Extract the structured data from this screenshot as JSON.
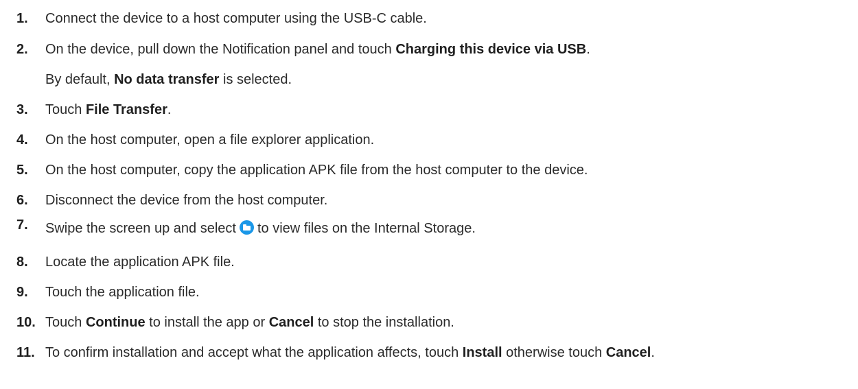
{
  "steps": [
    {
      "num": "1.",
      "text": "Connect the device to a host computer using the USB-C cable."
    },
    {
      "num": "2.",
      "pre": "On the device, pull down the Notification panel and touch ",
      "b1": "Charging this device via USB",
      "post": "."
    },
    {
      "note_pre": "By default, ",
      "note_b": "No data transfer",
      "note_post": " is selected."
    },
    {
      "num": "3.",
      "pre": "Touch ",
      "b1": "File Transfer",
      "post": "."
    },
    {
      "num": "4.",
      "text": "On the host computer, open a file explorer application."
    },
    {
      "num": "5.",
      "text": "On the host computer, copy the application APK file from the host computer to the device."
    },
    {
      "num": "6.",
      "text": "Disconnect the device from the host computer."
    },
    {
      "num": "7.",
      "pre": "Swipe the screen up and select",
      "post": "to view files on the Internal Storage.",
      "icon": "folder-icon"
    },
    {
      "num": "8.",
      "text": "Locate the application APK file."
    },
    {
      "num": "9.",
      "text": "Touch the application file."
    },
    {
      "num": "10.",
      "pre": "Touch ",
      "b1": "Continue",
      "mid": " to install the app or ",
      "b2": "Cancel",
      "post": " to stop the installation."
    },
    {
      "num": "11.",
      "pre": "To confirm installation and accept what the application affects, touch ",
      "b1": "Install",
      "mid": " otherwise touch ",
      "b2": "Cancel",
      "post": "."
    }
  ],
  "colors": {
    "text": "#2b2b2b",
    "icon": "#1a97e8"
  }
}
